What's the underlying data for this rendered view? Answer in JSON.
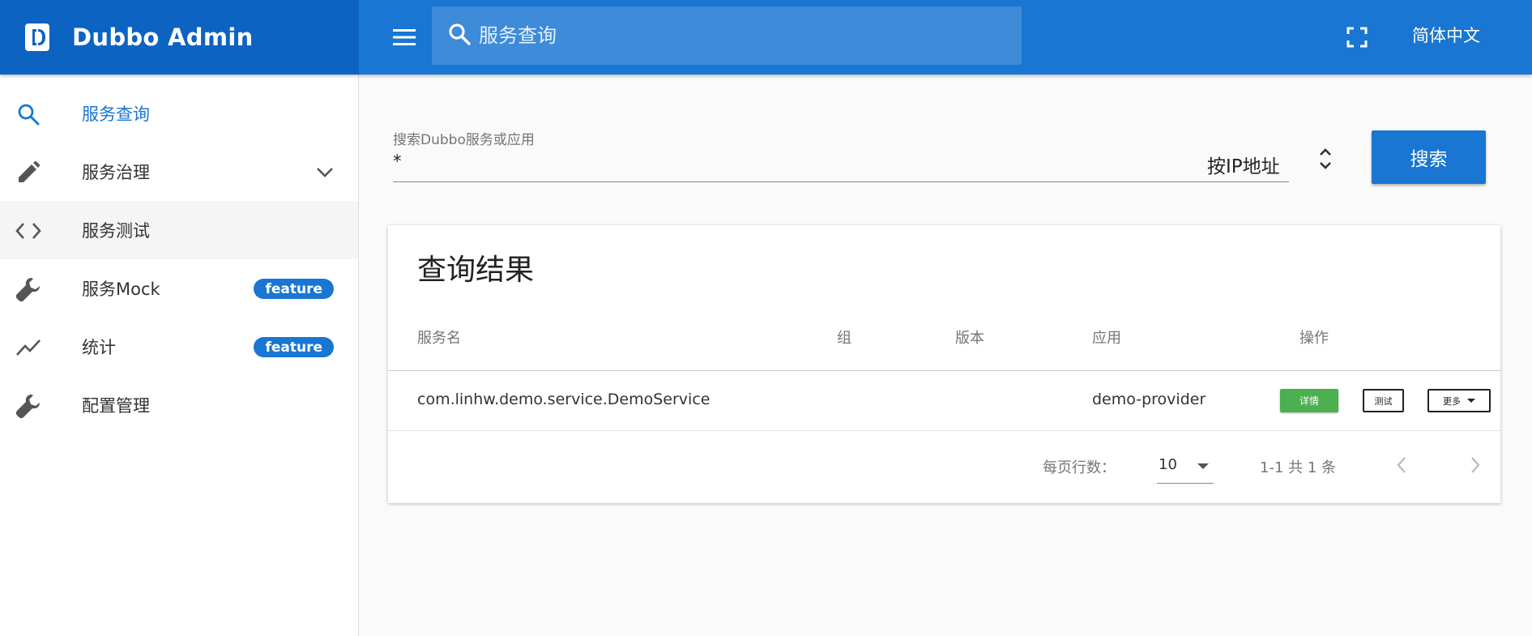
{
  "app": {
    "title": "Dubbo Admin"
  },
  "topbar": {
    "search_placeholder": "服务查询",
    "language": "简体中文"
  },
  "sidebar": {
    "items": [
      {
        "label": "服务查询",
        "icon": "search-icon"
      },
      {
        "label": "服务治理",
        "icon": "pencil-icon"
      },
      {
        "label": "服务测试",
        "icon": "code-icon"
      },
      {
        "label": "服务Mock",
        "icon": "wrench-icon",
        "badge": "feature"
      },
      {
        "label": "统计",
        "icon": "trending-icon",
        "badge": "feature"
      },
      {
        "label": "配置管理",
        "icon": "wrench-icon"
      }
    ]
  },
  "search": {
    "caption": "搜索Dubbo服务或应用",
    "value": "*",
    "filter": "按IP地址",
    "button": "搜索"
  },
  "results": {
    "title": "查询结果",
    "columns": [
      "服务名",
      "组",
      "版本",
      "应用",
      "操作"
    ],
    "rows": [
      {
        "service": "com.linhw.demo.service.DemoService",
        "group": "",
        "version": "",
        "app": "demo-provider"
      }
    ],
    "actions": {
      "detail": "详情",
      "test": "测试",
      "more": "更多"
    },
    "pagination": {
      "rows_per_page_label": "每页行数：",
      "rows_per_page": "10",
      "range": "1-1 共 1 条"
    }
  },
  "colors": {
    "brand_dark": "#0d63c2",
    "appbar": "#1976d2",
    "accent": "#1976d2",
    "success": "#4caf50"
  }
}
